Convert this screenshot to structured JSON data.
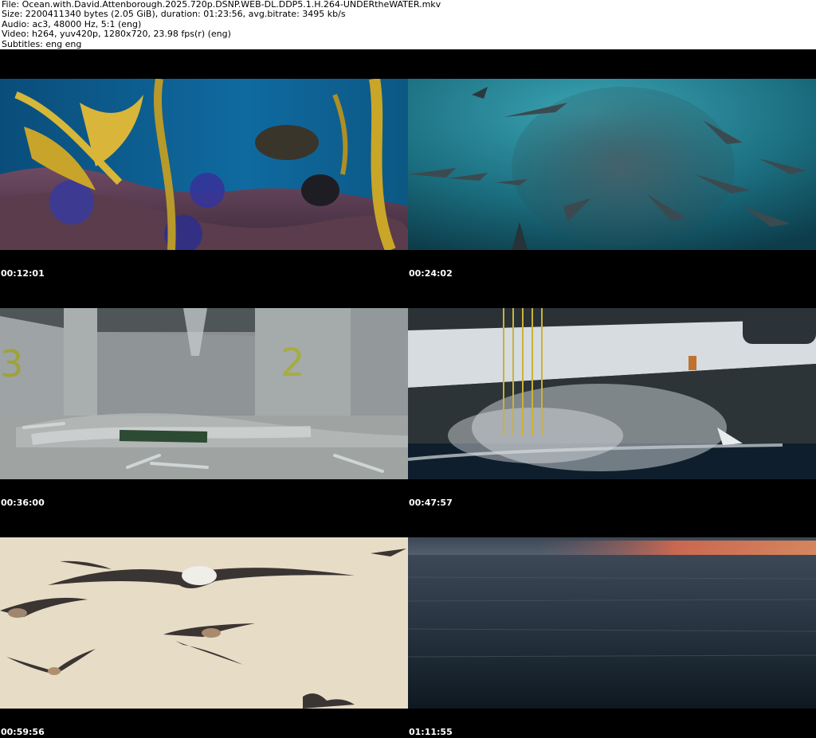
{
  "header": {
    "file": "File: Ocean.with.David.Attenborough.2025.720p.DSNP.WEB-DL.DDP5.1.H.264-UNDERtheWATER.mkv",
    "size": "Size: 2200411340 bytes (2.05 GiB), duration: 01:23:56, avg.bitrate: 3495 kb/s",
    "audio": "Audio: ac3, 48000 Hz, 5:1 (eng)",
    "video": "Video: h264, yuv420p, 1280x720, 23.98 fps(r) (eng)",
    "subtitles": "Subtitles: eng eng"
  },
  "frames": [
    {
      "timestamp": "00:12:01",
      "scene": "kelp-forest"
    },
    {
      "timestamp": "00:24:02",
      "scene": "shark-bait-ball"
    },
    {
      "timestamp": "00:36:00",
      "scene": "fish-hold",
      "labels": [
        "3",
        "2"
      ]
    },
    {
      "timestamp": "00:47:57",
      "scene": "trawler-hull"
    },
    {
      "timestamp": "00:59:56",
      "scene": "albatross-flight"
    },
    {
      "timestamp": "01:11:55",
      "scene": "ocean-horizon"
    }
  ]
}
